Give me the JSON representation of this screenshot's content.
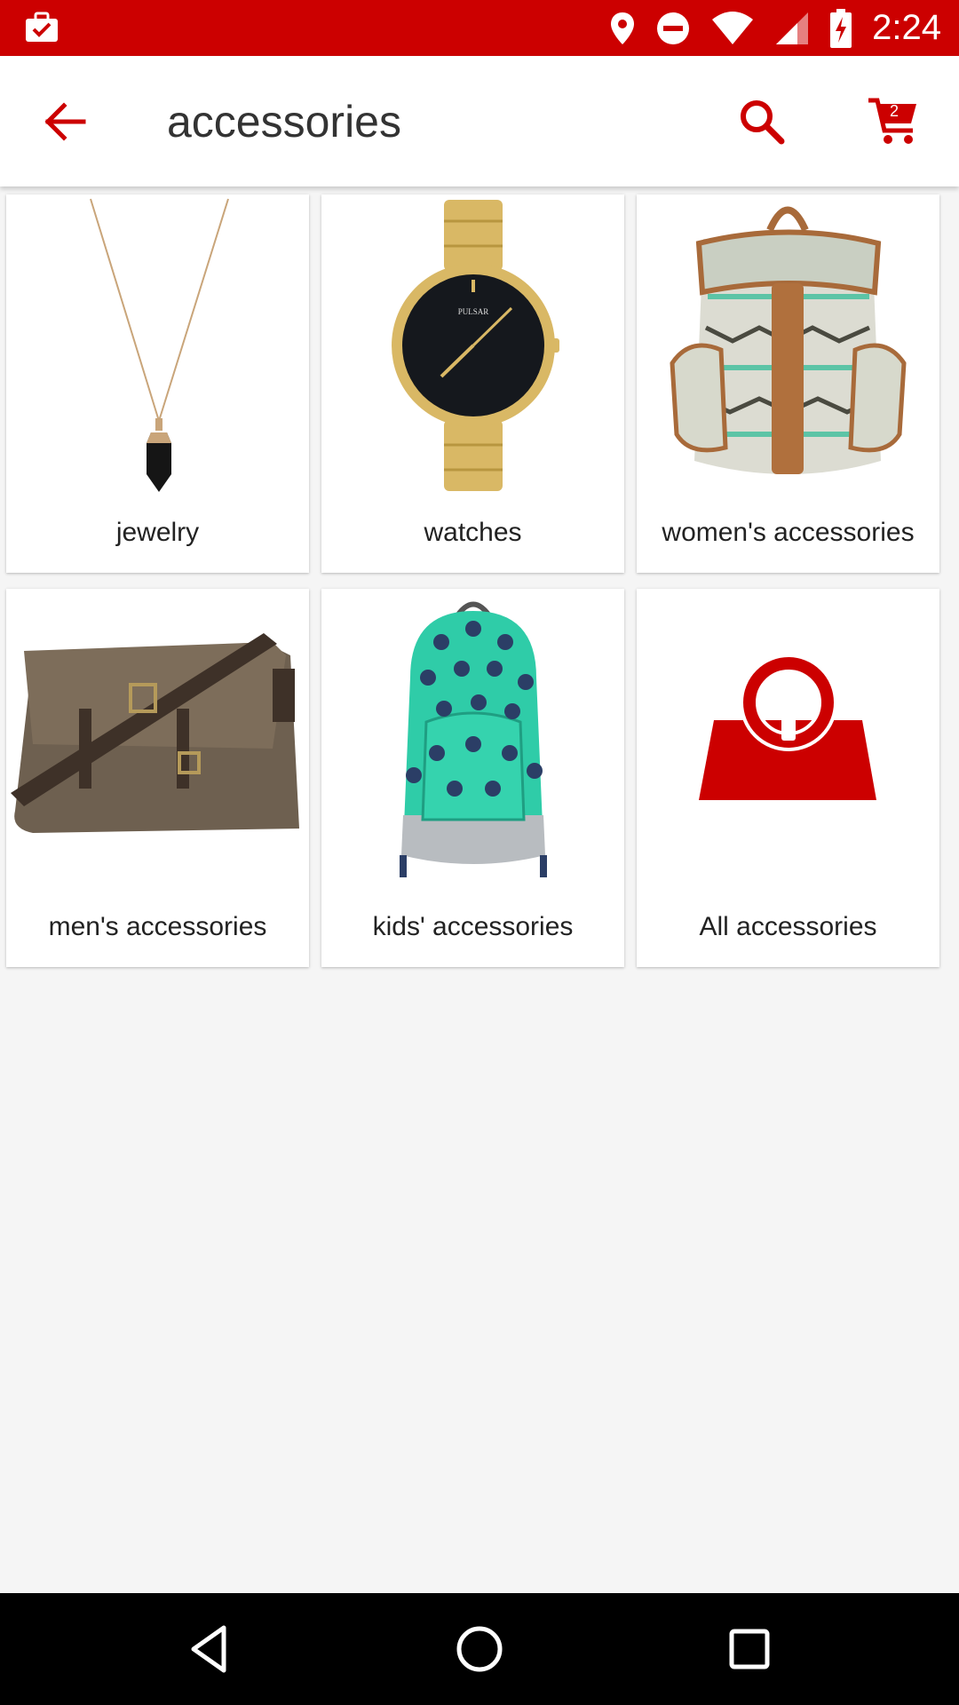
{
  "status_bar": {
    "time": "2:24",
    "icons": [
      "briefcase-check-icon",
      "location-pin-icon",
      "do-not-disturb-icon",
      "wifi-icon",
      "cell-signal-icon",
      "battery-charging-icon"
    ]
  },
  "app_bar": {
    "title": "accessories",
    "cart_count": "2",
    "accent_color": "#cc0000"
  },
  "categories": [
    {
      "label": "jewelry",
      "image": "necklace-image"
    },
    {
      "label": "watches",
      "image": "gold-watch-image"
    },
    {
      "label": "women's accessories",
      "image": "aztec-backpack-image"
    },
    {
      "label": "men's accessories",
      "image": "messenger-bag-image"
    },
    {
      "label": "kids' accessories",
      "image": "polka-dot-backpack-image"
    },
    {
      "label": "All accessories",
      "image": "red-handbag-icon"
    }
  ],
  "nav_bar": {
    "icons": [
      "back-triangle-icon",
      "home-circle-icon",
      "recents-square-icon"
    ]
  }
}
